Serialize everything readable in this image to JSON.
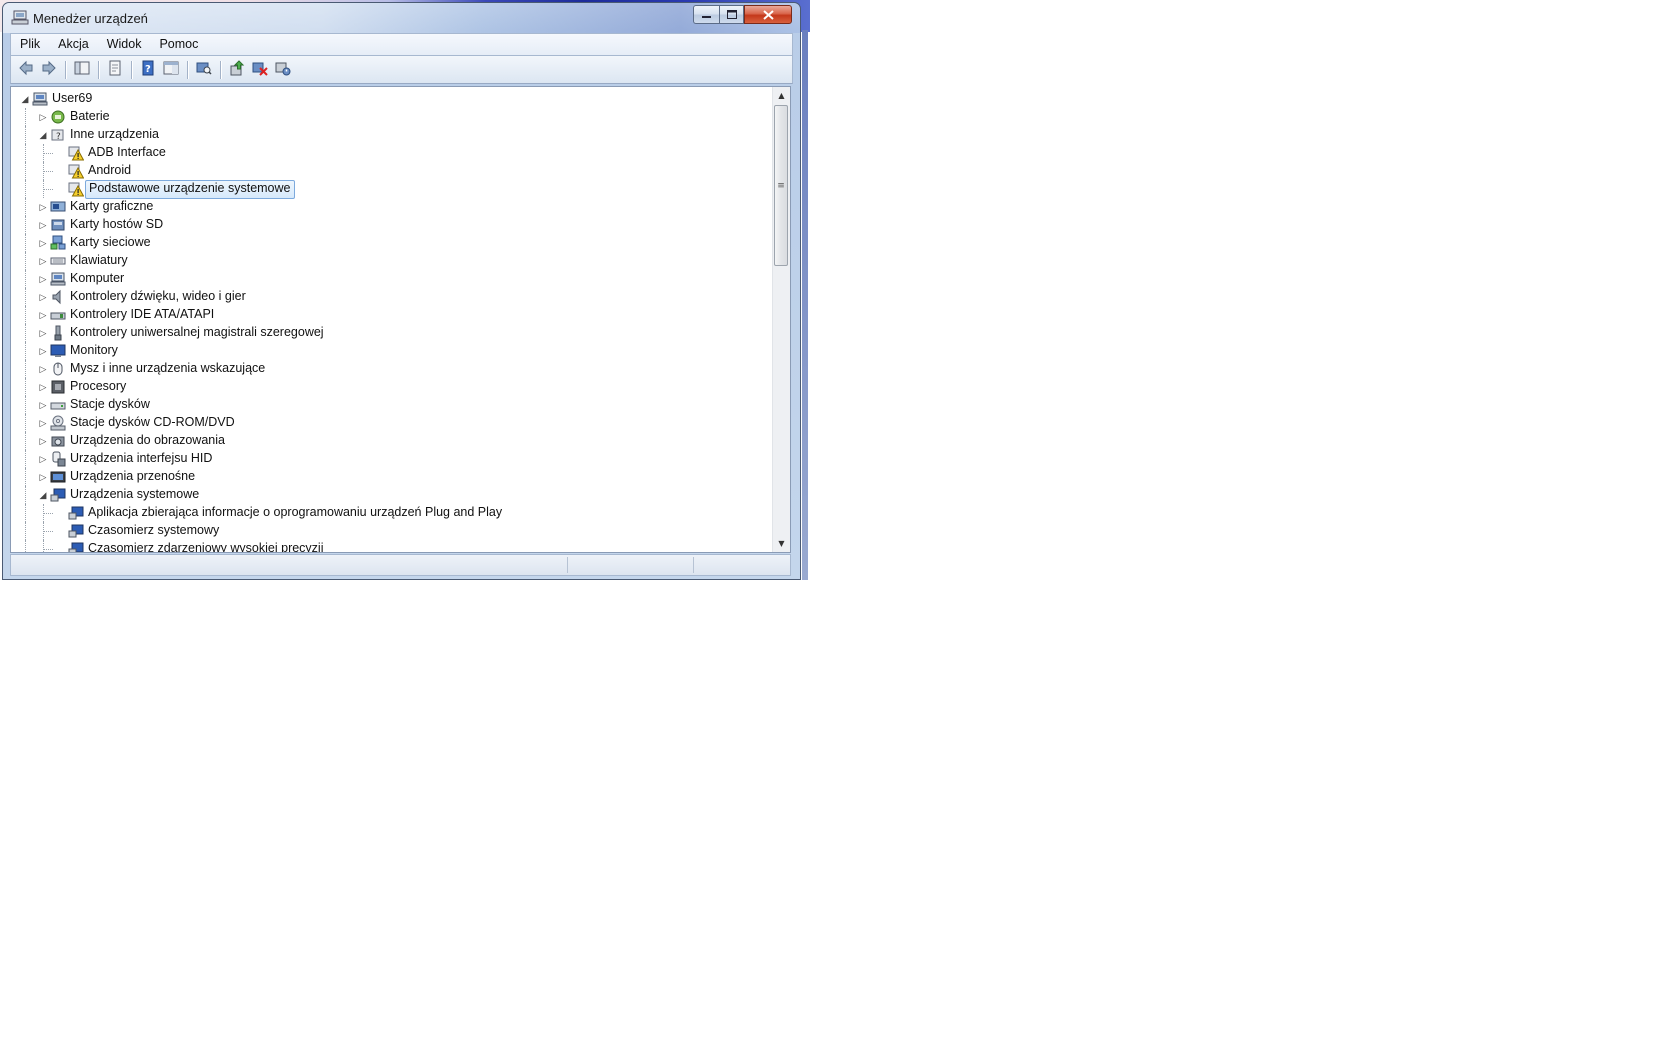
{
  "window": {
    "title": "Menedżer urządzeń",
    "icon": "device-manager-icon",
    "controls": {
      "minimize": "minimize-icon",
      "maximize": "maximize-icon",
      "close": "close-icon"
    }
  },
  "menu": [
    "Plik",
    "Akcja",
    "Widok",
    "Pomoc"
  ],
  "toolbar": [
    "back-arrow-icon",
    "forward-arrow-icon",
    "|",
    "console-tree-icon",
    "|",
    "properties-icon",
    "|",
    "help-icon",
    "show-hide-pane-icon",
    "|",
    "scan-hardware-icon",
    "|",
    "update-driver-icon",
    "uninstall-device-icon",
    "disable-device-icon"
  ],
  "tree": [
    {
      "level": 0,
      "label": "User69",
      "icon": "computer-icon",
      "expanded": true
    },
    {
      "level": 1,
      "label": "Baterie",
      "icon": "battery-icon",
      "expanded": false
    },
    {
      "level": 1,
      "label": "Inne urządzenia",
      "icon": "unknown-device-icon",
      "expanded": true
    },
    {
      "level": 2,
      "label": "ADB Interface",
      "icon": "warning-device-icon"
    },
    {
      "level": 2,
      "label": "Android",
      "icon": "warning-device-icon"
    },
    {
      "level": 2,
      "label": "Podstawowe urządzenie systemowe",
      "icon": "warning-device-icon",
      "selected": true
    },
    {
      "level": 1,
      "label": "Karty graficzne",
      "icon": "display-adapter-icon",
      "expanded": false
    },
    {
      "level": 1,
      "label": "Karty hostów SD",
      "icon": "sd-host-icon",
      "expanded": false
    },
    {
      "level": 1,
      "label": "Karty sieciowe",
      "icon": "network-adapter-icon",
      "expanded": false
    },
    {
      "level": 1,
      "label": "Klawiatury",
      "icon": "keyboard-icon",
      "expanded": false
    },
    {
      "level": 1,
      "label": "Komputer",
      "icon": "computer-icon",
      "expanded": false
    },
    {
      "level": 1,
      "label": "Kontrolery dźwięku, wideo i gier",
      "icon": "speaker-icon",
      "expanded": false
    },
    {
      "level": 1,
      "label": "Kontrolery IDE ATA/ATAPI",
      "icon": "ide-controller-icon",
      "expanded": false
    },
    {
      "level": 1,
      "label": "Kontrolery uniwersalnej magistrali szeregowej",
      "icon": "usb-icon",
      "expanded": false
    },
    {
      "level": 1,
      "label": "Monitory",
      "icon": "monitor-icon",
      "expanded": false
    },
    {
      "level": 1,
      "label": "Mysz i inne urządzenia wskazujące",
      "icon": "mouse-icon",
      "expanded": false
    },
    {
      "level": 1,
      "label": "Procesory",
      "icon": "processor-icon",
      "expanded": false
    },
    {
      "level": 1,
      "label": "Stacje dysków",
      "icon": "disk-drive-icon",
      "expanded": false
    },
    {
      "level": 1,
      "label": "Stacje dysków CD-ROM/DVD",
      "icon": "cdrom-icon",
      "expanded": false
    },
    {
      "level": 1,
      "label": "Urządzenia do obrazowania",
      "icon": "camera-icon",
      "expanded": false
    },
    {
      "level": 1,
      "label": "Urządzenia interfejsu HID",
      "icon": "hid-icon",
      "expanded": false
    },
    {
      "level": 1,
      "label": "Urządzenia przenośne",
      "icon": "portable-device-icon",
      "expanded": false
    },
    {
      "level": 1,
      "label": "Urządzenia systemowe",
      "icon": "system-device-icon",
      "expanded": true
    },
    {
      "level": 2,
      "label": "Aplikacja zbierająca informacje o oprogramowaniu urządzeń Plug and Play",
      "icon": "system-device-icon"
    },
    {
      "level": 2,
      "label": "Czasomierz systemowy",
      "icon": "system-device-icon"
    },
    {
      "level": 2,
      "label": "Czasomierz zdarzeniowy wysokiej precyzji",
      "icon": "system-device-icon"
    }
  ],
  "statusbar": {
    "panes": [
      "",
      "",
      ""
    ]
  }
}
